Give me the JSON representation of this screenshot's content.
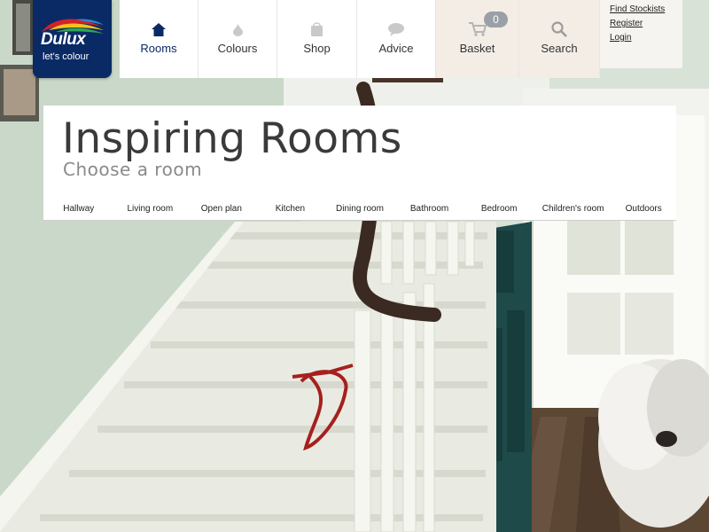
{
  "brand": {
    "name": "Dulux",
    "tagline": "let's colour",
    "colors": {
      "navy": "#0a2a66",
      "red": "#d6202a",
      "green": "#2fa84f",
      "yellow": "#f6c31c",
      "blue": "#2a8bd1"
    }
  },
  "nav": {
    "items": [
      {
        "label": "Rooms",
        "icon": "house-icon",
        "active": true
      },
      {
        "label": "Colours",
        "icon": "paint-drop-icon"
      },
      {
        "label": "Shop",
        "icon": "paint-tin-icon"
      },
      {
        "label": "Advice",
        "icon": "speech-bubble-icon"
      },
      {
        "label": "Basket",
        "icon": "basket-icon"
      },
      {
        "label": "Search",
        "icon": "magnifier-icon"
      }
    ],
    "basket_count": "0"
  },
  "utility": {
    "find_stockists": "Find Stockists",
    "register": "Register",
    "login": "Login"
  },
  "hero": {
    "title": "Inspiring Rooms",
    "subtitle": "Choose a room"
  },
  "rooms": [
    "Hallway",
    "Living room",
    "Open plan",
    "Kitchen",
    "Dining room",
    "Bathroom",
    "Bedroom",
    "Children's room",
    "Outdoors"
  ]
}
